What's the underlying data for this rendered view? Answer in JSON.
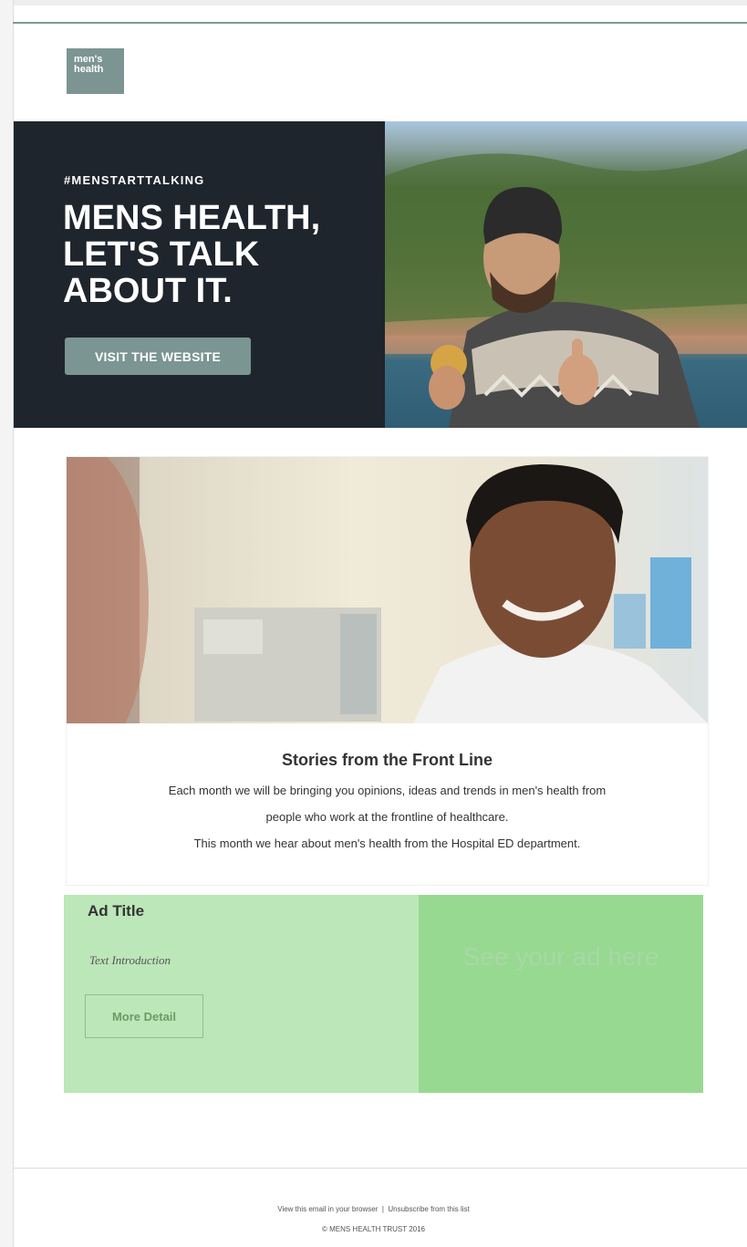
{
  "logo": {
    "line1": "men's",
    "line2": "health"
  },
  "hero": {
    "hashtag": "#MENSTARTTALKING",
    "title": "MENS HEALTH,\nLET'S TALK\nABOUT IT.",
    "button": "VISIT THE WEBSITE"
  },
  "story": {
    "title": "Stories from the Front Line",
    "line1": "Each month we will be bringing you opinions, ideas and trends in men's health from",
    "line2": "people who work at the frontline of healthcare.",
    "line3": "This month we hear about men's health from the Hospital ED department."
  },
  "ad": {
    "title": "Ad Title",
    "intro": "Text Introduction",
    "button": "More Detail",
    "placeholder": "See your ad here"
  },
  "footer": {
    "view_link": "View this email in your browser",
    "divider": "|",
    "unsubscribe_link": "Unsubscribe from this list",
    "copyright": "© MENS HEALTH TRUST 2016"
  },
  "colors": {
    "dark": "#1f252d",
    "accent": "#7a9592",
    "ad_light": "#bce7b9",
    "ad_dark": "#97d991"
  }
}
